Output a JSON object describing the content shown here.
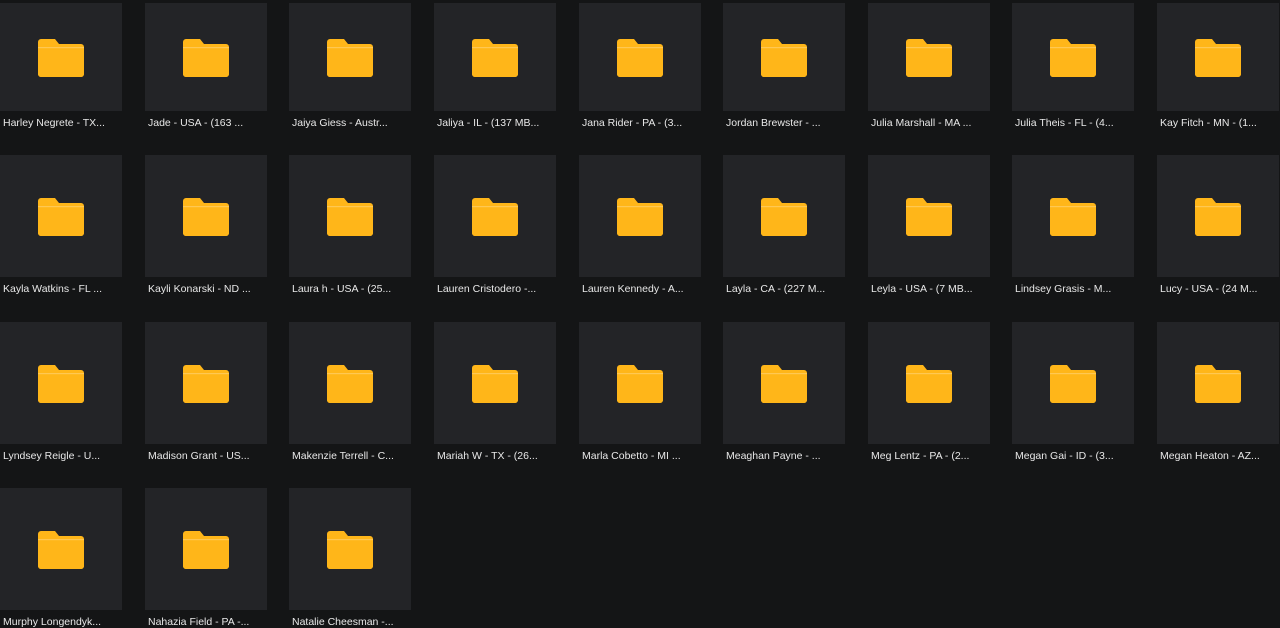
{
  "folder_icon_color": "#FFB619",
  "folders": [
    {
      "name": "Harley Negrete - TX..."
    },
    {
      "name": "Jade - USA - (163 ..."
    },
    {
      "name": "Jaiya Giess - Austr..."
    },
    {
      "name": "Jaliya - IL - (137 MB..."
    },
    {
      "name": "Jana Rider - PA - (3..."
    },
    {
      "name": "Jordan Brewster - ..."
    },
    {
      "name": "Julia Marshall - MA ..."
    },
    {
      "name": "Julia Theis - FL - (4..."
    },
    {
      "name": "Kay Fitch - MN - (1..."
    },
    {
      "name": "Kayla Watkins - FL ..."
    },
    {
      "name": "Kayli Konarski - ND ..."
    },
    {
      "name": "Laura h - USA - (25..."
    },
    {
      "name": "Lauren Cristodero -..."
    },
    {
      "name": "Lauren Kennedy - A..."
    },
    {
      "name": "Layla - CA - (227 M..."
    },
    {
      "name": "Leyla - USA - (7 MB..."
    },
    {
      "name": "Lindsey Grasis - M..."
    },
    {
      "name": "Lucy - USA - (24 M..."
    },
    {
      "name": "Lyndsey Reigle - U..."
    },
    {
      "name": "Madison Grant - US..."
    },
    {
      "name": "Makenzie Terrell - C..."
    },
    {
      "name": "Mariah W - TX - (26..."
    },
    {
      "name": "Marla Cobetto - MI ..."
    },
    {
      "name": "Meaghan Payne - ..."
    },
    {
      "name": "Meg Lentz - PA - (2..."
    },
    {
      "name": "Megan Gai - ID - (3..."
    },
    {
      "name": "Megan Heaton - AZ..."
    },
    {
      "name": "Murphy Longendyk..."
    },
    {
      "name": "Nahazia Field - PA -..."
    },
    {
      "name": "Natalie Cheesman -..."
    }
  ]
}
